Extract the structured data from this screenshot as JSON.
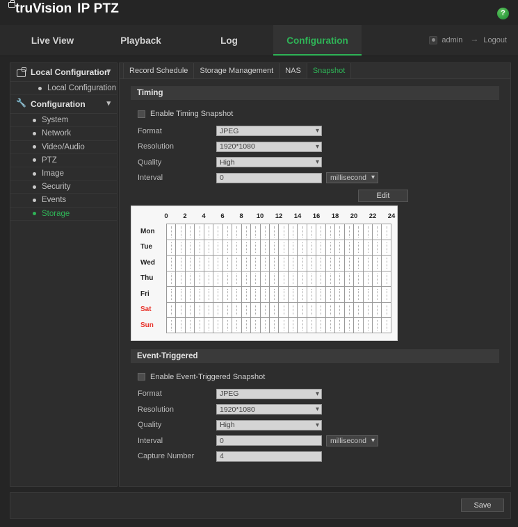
{
  "header": {
    "brand": "truVision",
    "model": "IP PTZ",
    "logo_icon": "camera-icon",
    "help_icon": "help-question-icon",
    "help_label": "?"
  },
  "nav": {
    "items": [
      {
        "label": "Live View",
        "active": false
      },
      {
        "label": "Playback",
        "active": false
      },
      {
        "label": "Log",
        "active": false
      },
      {
        "label": "Configuration",
        "active": true
      }
    ],
    "user": "admin",
    "logout": "Logout",
    "user_icon": "user-icon",
    "logout_icon": "logout-arrow-icon"
  },
  "sidebar": {
    "groups": [
      {
        "title": "Local Configuration",
        "icon": "camera-icon",
        "chevron": "chevron-down-icon",
        "items": [
          {
            "label": "Local Configuration",
            "active": false
          }
        ]
      },
      {
        "title": "Configuration",
        "icon": "wrench-icon",
        "chevron": "chevron-down-icon",
        "items": [
          {
            "label": "System",
            "active": false
          },
          {
            "label": "Network",
            "active": false
          },
          {
            "label": "Video/Audio",
            "active": false
          },
          {
            "label": "PTZ",
            "active": false
          },
          {
            "label": "Image",
            "active": false
          },
          {
            "label": "Security",
            "active": false
          },
          {
            "label": "Events",
            "active": false
          },
          {
            "label": "Storage",
            "active": true
          }
        ]
      }
    ]
  },
  "tabs": [
    {
      "label": "Record Schedule",
      "active": false
    },
    {
      "label": "Storage Management",
      "active": false
    },
    {
      "label": "NAS",
      "active": false
    },
    {
      "label": "Snapshot",
      "active": true
    }
  ],
  "timing": {
    "section_title": "Timing",
    "enable_label": "Enable Timing Snapshot",
    "enable_checked": false,
    "fields": {
      "format_label": "Format",
      "format_value": "JPEG",
      "resolution_label": "Resolution",
      "resolution_value": "1920*1080",
      "quality_label": "Quality",
      "quality_value": "High",
      "interval_label": "Interval",
      "interval_value": "0",
      "interval_unit": "millisecond"
    },
    "edit_label": "Edit"
  },
  "schedule": {
    "hours": [
      "0",
      "2",
      "4",
      "6",
      "8",
      "10",
      "12",
      "14",
      "16",
      "18",
      "20",
      "22",
      "24"
    ],
    "days": [
      {
        "label": "Mon",
        "weekend": false
      },
      {
        "label": "Tue",
        "weekend": false
      },
      {
        "label": "Wed",
        "weekend": false
      },
      {
        "label": "Thu",
        "weekend": false
      },
      {
        "label": "Fri",
        "weekend": false
      },
      {
        "label": "Sat",
        "weekend": true
      },
      {
        "label": "Sun",
        "weekend": true
      }
    ],
    "columns": 24
  },
  "event_triggered": {
    "section_title": "Event-Triggered",
    "enable_label": "Enable Event-Triggered Snapshot",
    "enable_checked": false,
    "fields": {
      "format_label": "Format",
      "format_value": "JPEG",
      "resolution_label": "Resolution",
      "resolution_value": "1920*1080",
      "quality_label": "Quality",
      "quality_value": "High",
      "interval_label": "Interval",
      "interval_value": "0",
      "interval_unit": "millisecond",
      "capture_number_label": "Capture Number",
      "capture_number_value": "4"
    }
  },
  "footer": {
    "save_label": "Save"
  },
  "colors": {
    "accent": "#2fb457",
    "weekend": "#e8342c",
    "panel": "#2d2d2d",
    "background": "#252525"
  }
}
